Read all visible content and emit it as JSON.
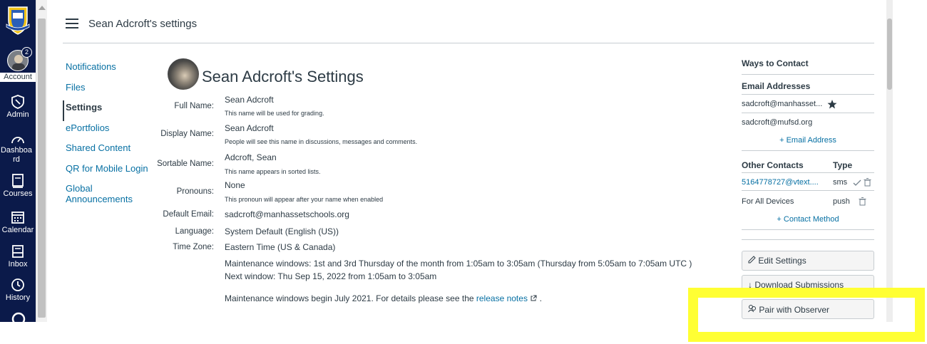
{
  "header": {
    "breadcrumb": "Sean Adcroft's settings"
  },
  "global_nav": [
    {
      "label": "Account",
      "icon": "avatar",
      "badge": "2"
    },
    {
      "label": "Admin",
      "icon": "shield-icon"
    },
    {
      "label": "Dashboa rd",
      "icon": "dashboard-icon"
    },
    {
      "label": "Courses",
      "icon": "book-icon"
    },
    {
      "label": "Calendar",
      "icon": "calendar-icon"
    },
    {
      "label": "Inbox",
      "icon": "inbox-icon"
    },
    {
      "label": "History",
      "icon": "clock-icon"
    }
  ],
  "subnav": {
    "notifications": "Notifications",
    "files": "Files",
    "settings": "Settings",
    "eportfolios": "ePortfolios",
    "shared_content": "Shared Content",
    "qr_login": "QR for Mobile Login",
    "global_announcements": "Global Announcements"
  },
  "profile": {
    "title": "Sean Adcroft's Settings",
    "full_name_label": "Full Name:",
    "full_name": "Sean Adcroft",
    "full_name_hint": "This name will be used for grading.",
    "display_name_label": "Display Name:",
    "display_name": "Sean Adcroft",
    "display_name_hint": "People will see this name in discussions, messages and comments.",
    "sortable_name_label": "Sortable Name:",
    "sortable_name": "Adcroft, Sean",
    "sortable_name_hint": "This name appears in sorted lists.",
    "pronouns_label": "Pronouns:",
    "pronouns": "None",
    "pronouns_hint": "This pronoun will appear after your name when enabled",
    "default_email_label": "Default Email:",
    "default_email": "sadcroft@manhassetschools.org",
    "language_label": "Language:",
    "language": "System Default (English (US))",
    "time_zone_label": "Time Zone:",
    "time_zone": "Eastern Time (US & Canada)",
    "maintenance_1": "Maintenance windows: 1st and 3rd Thursday of the month from 1:05am to 3:05am (Thursday from 5:05am to 7:05am UTC )",
    "maintenance_2": "Next window: Thu Sep 15, 2022 from 1:05am to 3:05am",
    "maintenance_3": "Maintenance windows begin July 2021. For details please see the",
    "release_notes": "release notes",
    "maintenance_end": "."
  },
  "contact": {
    "heading": "Ways to Contact",
    "email_heading": "Email Addresses",
    "emails": [
      "sadcroft@manhasset...",
      "sadcroft@mufsd.org"
    ],
    "add_email": "+ Email Address",
    "other_heading": "Other Contacts",
    "type_heading": "Type",
    "other": [
      {
        "name": "5164778727@vtext....",
        "type": "sms"
      },
      {
        "name": "For All Devices",
        "type": "push"
      }
    ],
    "add_contact": "+ Contact Method"
  },
  "buttons": {
    "edit": "Edit Settings",
    "download": "Download Submissions",
    "pair": "Pair with Observer"
  },
  "colors": {
    "nav_bg": "#0b1a4a",
    "link": "#0770a3",
    "highlight": "#ffff33"
  }
}
